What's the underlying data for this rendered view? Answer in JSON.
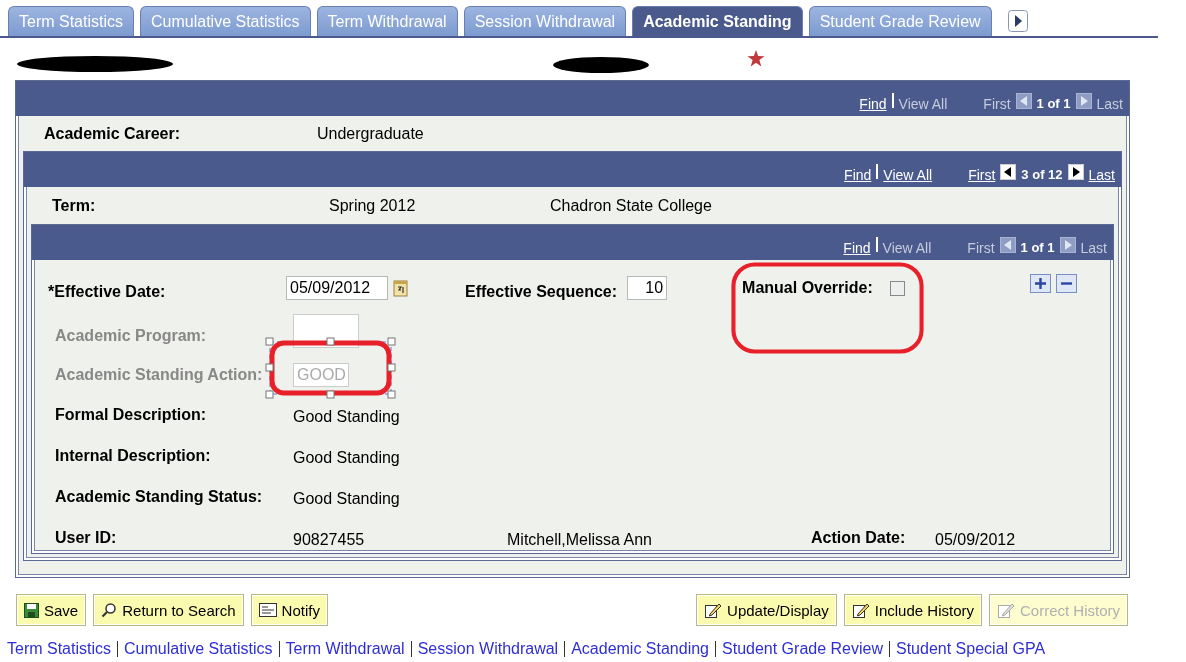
{
  "tabs": [
    {
      "label": "Term Statistics",
      "selected": false
    },
    {
      "label": "Cumulative Statistics",
      "selected": false
    },
    {
      "label": "Term Withdrawal",
      "selected": false
    },
    {
      "label": "Session Withdrawal",
      "selected": false
    },
    {
      "label": "Academic Standing",
      "selected": true
    },
    {
      "label": "Student Grade Review",
      "selected": false
    }
  ],
  "career_grid": {
    "nav": [
      {
        "kind": "link",
        "label": "Find",
        "disabled": false
      },
      {
        "kind": "link",
        "label": "View All",
        "disabled": true
      },
      {
        "kind": "link",
        "label": "First",
        "disabled": true
      },
      {
        "kind": "prev",
        "disabled": true
      },
      {
        "kind": "count",
        "label": "1 of 1"
      },
      {
        "kind": "next",
        "disabled": true
      },
      {
        "kind": "link",
        "label": "Last",
        "disabled": true
      }
    ],
    "label": "Academic Career:",
    "value": "Undergraduate"
  },
  "term_grid": {
    "nav": [
      {
        "kind": "link",
        "label": "Find",
        "disabled": false
      },
      {
        "kind": "link",
        "label": "View All",
        "disabled": false
      },
      {
        "kind": "link",
        "label": "First",
        "disabled": false
      },
      {
        "kind": "prev",
        "disabled": false
      },
      {
        "kind": "count",
        "label": "3 of 12"
      },
      {
        "kind": "next",
        "disabled": false
      },
      {
        "kind": "link",
        "label": "Last",
        "disabled": false
      }
    ],
    "label": "Term:",
    "value": "Spring 2012",
    "institution": "Chadron State College"
  },
  "standing_grid": {
    "nav": [
      {
        "kind": "link",
        "label": "Find",
        "disabled": false
      },
      {
        "kind": "link",
        "label": "View All",
        "disabled": true
      },
      {
        "kind": "link",
        "label": "First",
        "disabled": true
      },
      {
        "kind": "prev",
        "disabled": true
      },
      {
        "kind": "count",
        "label": "1 of 1"
      },
      {
        "kind": "next",
        "disabled": true
      },
      {
        "kind": "link",
        "label": "Last",
        "disabled": true
      }
    ],
    "effective_date": {
      "label": "*Effective Date:",
      "value": "05/09/2012"
    },
    "effective_sequence": {
      "label": "Effective Sequence:",
      "value": "10"
    },
    "manual_override": {
      "label": "Manual Override:",
      "checked": false
    },
    "academic_program": {
      "label": "Academic Program:",
      "disabled": true
    },
    "standing_action": {
      "label": "Academic Standing Action:",
      "value": "GOOD",
      "disabled": true
    },
    "details": [
      {
        "label": "Formal Description:",
        "value": "Good Standing"
      },
      {
        "label": "Internal Description:",
        "value": "Good Standing"
      },
      {
        "label": "Academic Standing Status:",
        "value": "Good Standing"
      }
    ],
    "user": {
      "label": "User ID:",
      "value": "90827455",
      "name": "Mitchell,Melissa Ann",
      "action_date_label": "Action Date:",
      "action_date": "05/09/2012"
    }
  },
  "left_buttons": [
    {
      "label": "Save",
      "kind": "save",
      "disabled": false
    },
    {
      "label": "Return to Search",
      "kind": "search",
      "disabled": false
    },
    {
      "label": "Notify",
      "kind": "notify",
      "disabled": false
    }
  ],
  "right_buttons": [
    {
      "label": "Update/Display",
      "kind": "edit",
      "disabled": false
    },
    {
      "label": "Include History",
      "kind": "edit",
      "disabled": false
    },
    {
      "label": "Correct History",
      "kind": "edit",
      "disabled": true
    }
  ],
  "footer_links": [
    "Term Statistics",
    "Cumulative Statistics",
    "Term Withdrawal",
    "Session Withdrawal",
    "Academic Standing",
    "Student Grade Review",
    "Student Special GPA"
  ]
}
